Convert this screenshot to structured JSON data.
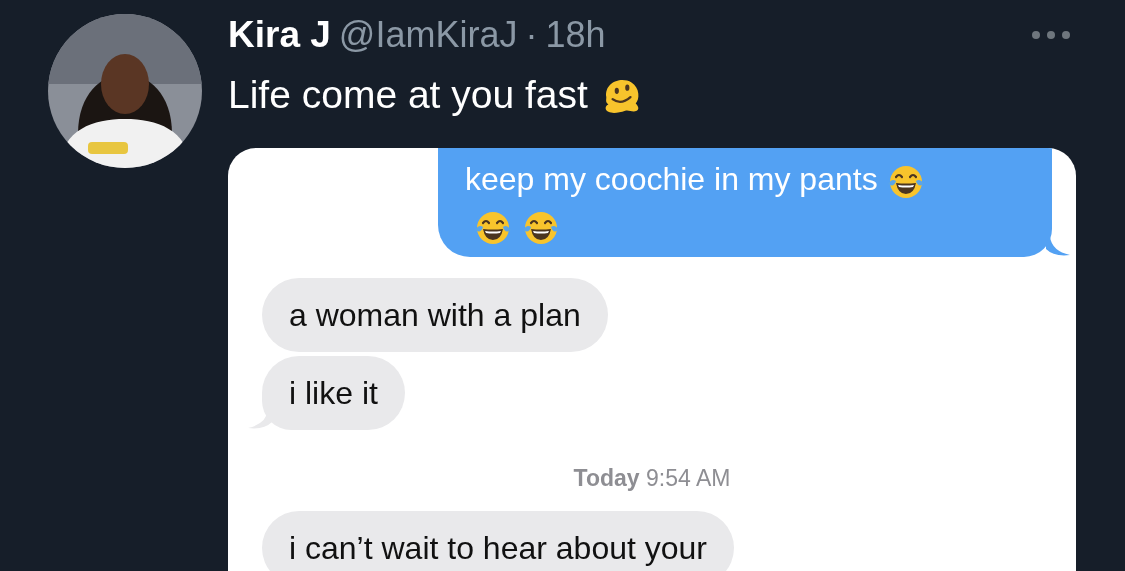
{
  "tweet": {
    "author_name": "Kira J",
    "handle": "@IamKiraJ",
    "separator": "·",
    "time": "18h",
    "text": "Life come at you fast",
    "trailing_icons": [
      {
        "kind": "melting"
      }
    ]
  },
  "conversation": [
    {
      "kind": "sent",
      "text": "keep my coochie in my pants",
      "trailing_icons": [
        {
          "kind": "laughing"
        },
        {
          "kind": "laughing"
        },
        {
          "kind": "laughing"
        }
      ],
      "tail": true
    },
    {
      "kind": "received",
      "text": "a woman with a plan",
      "tail": false
    },
    {
      "kind": "received",
      "text": "i like it",
      "tail": true
    },
    {
      "kind": "timestamp",
      "text": "**Today** 9:54 AM"
    },
    {
      "kind": "received",
      "text": "i can’t wait to hear about your",
      "tail": false
    }
  ]
}
